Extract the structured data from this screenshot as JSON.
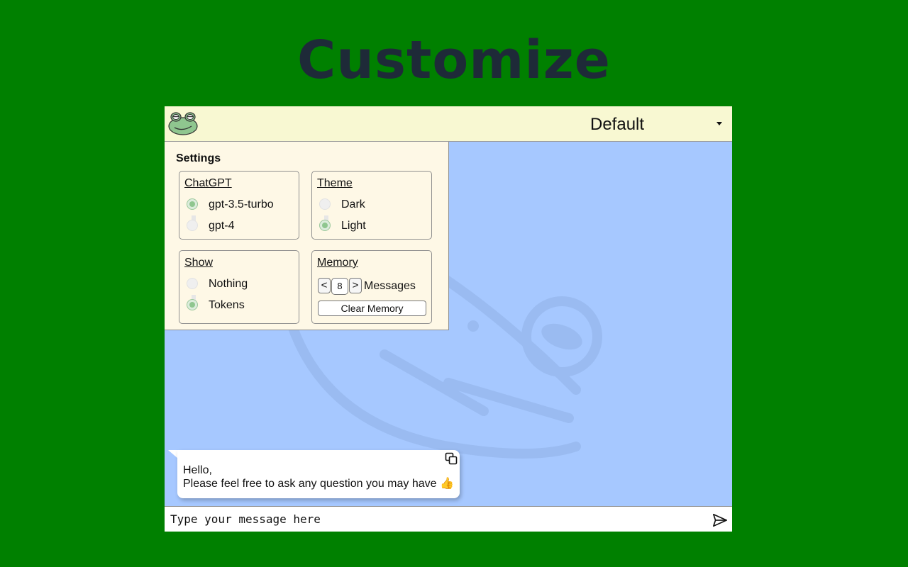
{
  "page": {
    "title": "Customize",
    "background_color": "#008000"
  },
  "topbar": {
    "logo_icon": "frog-icon",
    "persona_value": "Default"
  },
  "settings": {
    "title": "Settings",
    "chatgpt": {
      "label": "ChatGPT",
      "options": [
        "gpt-3.5-turbo",
        "gpt-4"
      ],
      "selected": "gpt-3.5-turbo"
    },
    "theme": {
      "label": "Theme",
      "options": [
        "Dark",
        "Light"
      ],
      "selected": "Light"
    },
    "show": {
      "label": "Show",
      "options": [
        "Nothing",
        "Tokens"
      ],
      "selected": "Tokens"
    },
    "memory": {
      "label": "Memory",
      "decrement_label": "<",
      "increment_label": ">",
      "value": "8",
      "unit_label": "Messages",
      "clear_label": "Clear Memory"
    }
  },
  "chat": {
    "background_color": "#a6c8ff",
    "messages": [
      {
        "line1": "Hello,",
        "line2": "Please feel free to ask any question you may have 👍"
      }
    ]
  },
  "composer": {
    "placeholder": "Type your message here",
    "send_icon": "send-icon"
  },
  "colors": {
    "topbar": "#f8f8d2",
    "settings_panel": "#fef8e6",
    "radio_selected": "#8fc68f",
    "title_text": "#1e2a38"
  }
}
